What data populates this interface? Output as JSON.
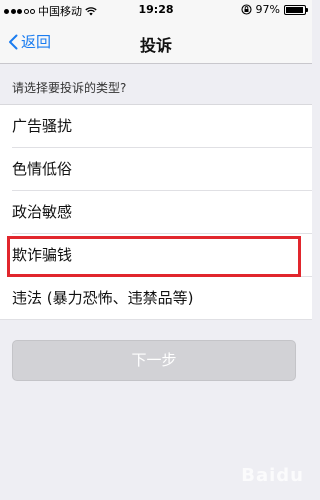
{
  "status_bar": {
    "carrier": "中国移动",
    "time": "19:28",
    "battery_percent": "97%",
    "battery_level": 0.97,
    "signal_bars": 5,
    "signal_filled": 3
  },
  "nav": {
    "back_label": "返回",
    "title": "投诉"
  },
  "section_header": "请选择要投诉的类型?",
  "options": [
    {
      "label": "广告骚扰"
    },
    {
      "label": "色情低俗"
    },
    {
      "label": "政治敏感"
    },
    {
      "label": "欺诈骗钱"
    },
    {
      "label": "违法 (暴力恐怖、违禁品等)"
    }
  ],
  "highlighted_option_index": 3,
  "next_button_label": "下一步",
  "watermark_text": "Baidu",
  "colors": {
    "accent": "#1a7cf0",
    "highlight": "#e1262d",
    "disabled_button": "#d2d2d6"
  }
}
